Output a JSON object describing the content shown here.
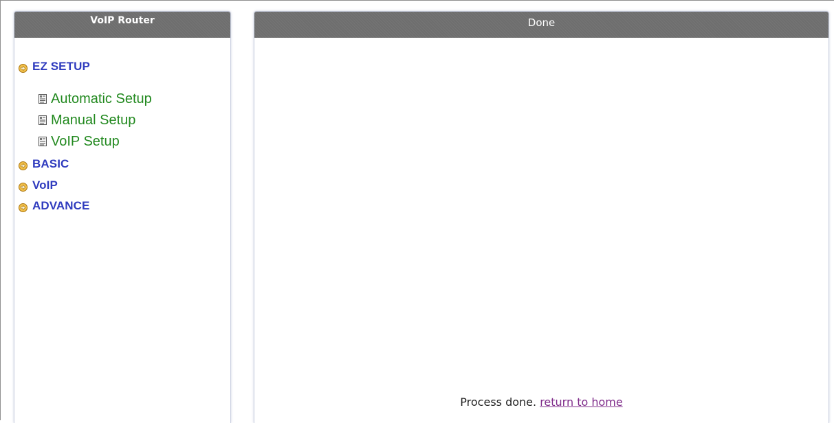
{
  "sidebar": {
    "title": "VoIP Router",
    "sections": [
      {
        "label": "EZ SETUP",
        "items": [
          {
            "label": "Automatic Setup"
          },
          {
            "label": "Manual Setup"
          },
          {
            "label": "VoIP Setup"
          }
        ]
      },
      {
        "label": "BASIC"
      },
      {
        "label": "VoIP"
      },
      {
        "label": "ADVANCE"
      }
    ]
  },
  "main": {
    "title": "Done",
    "message": "Process done.",
    "link_label": "return to home"
  },
  "colors": {
    "header_bg": "#6e6e6e",
    "section_label": "#2f3bbe",
    "item_label": "#22891f",
    "link": "#7e2a89",
    "arrow": "#e8a317"
  },
  "icons": {
    "section_bullet": "arrow-right-circle-icon",
    "item_bullet": "document-icon"
  }
}
